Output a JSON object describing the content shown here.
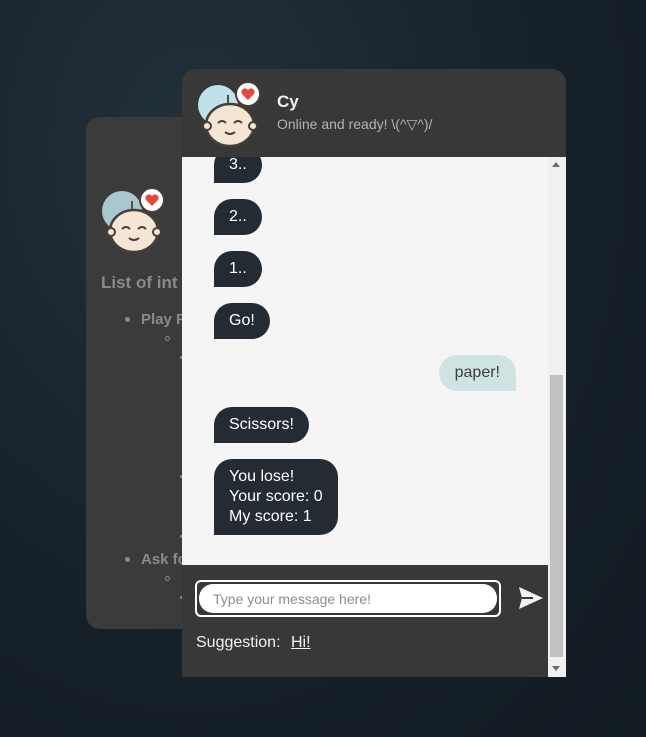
{
  "back_panel": {
    "title": "List of int",
    "items": [
      {
        "label": "Play R"
      },
      {
        "label": "Ask fo"
      }
    ]
  },
  "chat": {
    "bot_name": "Cy",
    "status": "Online and ready! \\(^▽^)/",
    "messages": [
      {
        "from": "bot",
        "text": "3.."
      },
      {
        "from": "bot",
        "text": "2.."
      },
      {
        "from": "bot",
        "text": "1.."
      },
      {
        "from": "bot",
        "text": "Go!"
      },
      {
        "from": "user",
        "text": "paper!"
      },
      {
        "from": "bot",
        "text": "Scissors!"
      },
      {
        "from": "bot",
        "lines": [
          "You lose!",
          "Your score: 0",
          "My score: 1"
        ]
      }
    ],
    "input": {
      "placeholder": "Type your message here!",
      "value": ""
    },
    "send_icon": "send-icon",
    "suggestion": {
      "label": "Suggestion:",
      "value": "Hi!"
    }
  },
  "colors": {
    "bot_bubble": "#252b33",
    "user_bubble": "#cfe3e2",
    "panel": "#383838",
    "avatar_heart": "#e8473d",
    "avatar_circle": "#bfe1e8"
  }
}
